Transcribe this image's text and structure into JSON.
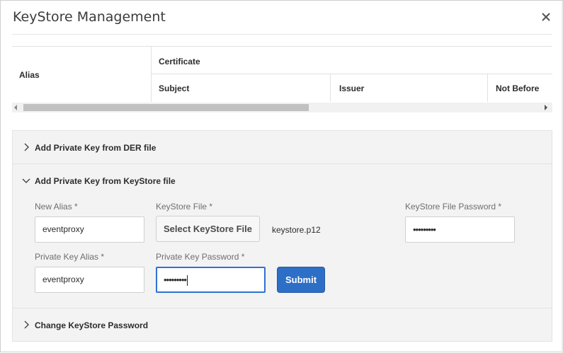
{
  "dialog": {
    "title": "KeyStore Management",
    "close_icon": "close-icon"
  },
  "table": {
    "columns": {
      "alias": "Alias",
      "certificate": "Certificate",
      "subject": "Subject",
      "issuer": "Issuer",
      "not_before": "Not Before"
    },
    "rows": []
  },
  "accordion": {
    "sections": [
      {
        "label": "Add Private Key from DER file",
        "expanded": false,
        "icon": "chevron-right-icon"
      },
      {
        "label": "Add Private Key from KeyStore file",
        "expanded": true,
        "icon": "chevron-down-icon"
      },
      {
        "label": "Change KeyStore Password",
        "expanded": false,
        "icon": "chevron-right-icon"
      }
    ]
  },
  "form": {
    "new_alias": {
      "label": "New Alias *",
      "value": "eventproxy"
    },
    "keystore_file": {
      "label": "KeyStore File *",
      "button": "Select KeyStore File",
      "file_name": "keystore.p12"
    },
    "keystore_password": {
      "label": "KeyStore File Password *",
      "value": "•••••••••"
    },
    "private_key_alias": {
      "label": "Private Key Alias *",
      "value": "eventproxy"
    },
    "private_key_password": {
      "label": "Private Key Password *",
      "value": "•••••••••"
    },
    "submit": "Submit"
  },
  "colors": {
    "accent": "#2d6fc6",
    "focus_border": "#2d72d2",
    "panel_bg": "#f3f3f3"
  }
}
